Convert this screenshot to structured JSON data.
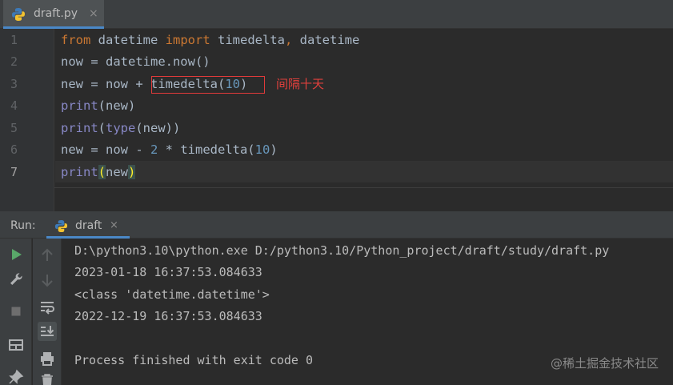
{
  "editor_tab": {
    "filename": "draft.py",
    "close": "×"
  },
  "gutter": [
    "1",
    "2",
    "3",
    "4",
    "5",
    "6",
    "7"
  ],
  "code": {
    "l1": {
      "kw1": "from",
      "mod": " datetime ",
      "kw2": "import",
      "names": " timedelta",
      "comma": ",",
      "rest": " datetime"
    },
    "l2": "now = datetime.now()",
    "l3": {
      "pre": "new = now + ",
      "call": "timedelta(",
      "num": "10",
      "close": ")"
    },
    "l4": {
      "fn": "print",
      "rest": "(new)"
    },
    "l5": {
      "fn": "print",
      "open": "(",
      "fn2": "type",
      "rest": "(new))"
    },
    "l6": {
      "pre": "new = now - ",
      "num": "2",
      "mid": " * timedelta(",
      "num2": "10",
      "close": ")"
    },
    "l7": {
      "fn": "print",
      "open": "(",
      "arg": "new",
      "close": ")"
    }
  },
  "annotation": "间隔十天",
  "run": {
    "label": "Run:",
    "tab": "draft",
    "close": "×"
  },
  "console": [
    "D:\\python3.10\\python.exe D:/python3.10/Python_project/draft/study/draft.py",
    "2023-01-18 16:37:53.084633",
    "<class 'datetime.datetime'>",
    "2022-12-19 16:37:53.084633",
    "",
    "Process finished with exit code 0"
  ],
  "watermark": "@稀土掘金技术社区",
  "icons": {
    "python": "python-file-icon",
    "run": "play-icon",
    "wrench": "wrench-icon",
    "stop": "stop-icon",
    "layout": "layout-icon",
    "pin": "pin-icon",
    "up": "arrow-up-icon",
    "down": "arrow-down-icon",
    "wrap": "soft-wrap-icon",
    "scroll": "scroll-to-end-icon",
    "print": "print-icon",
    "trash": "trash-icon"
  },
  "colors": {
    "accent": "#4a88c7",
    "keyword": "#cc7832",
    "number": "#6897bb",
    "builtin": "#8888c6",
    "annotation": "#e0403c"
  }
}
